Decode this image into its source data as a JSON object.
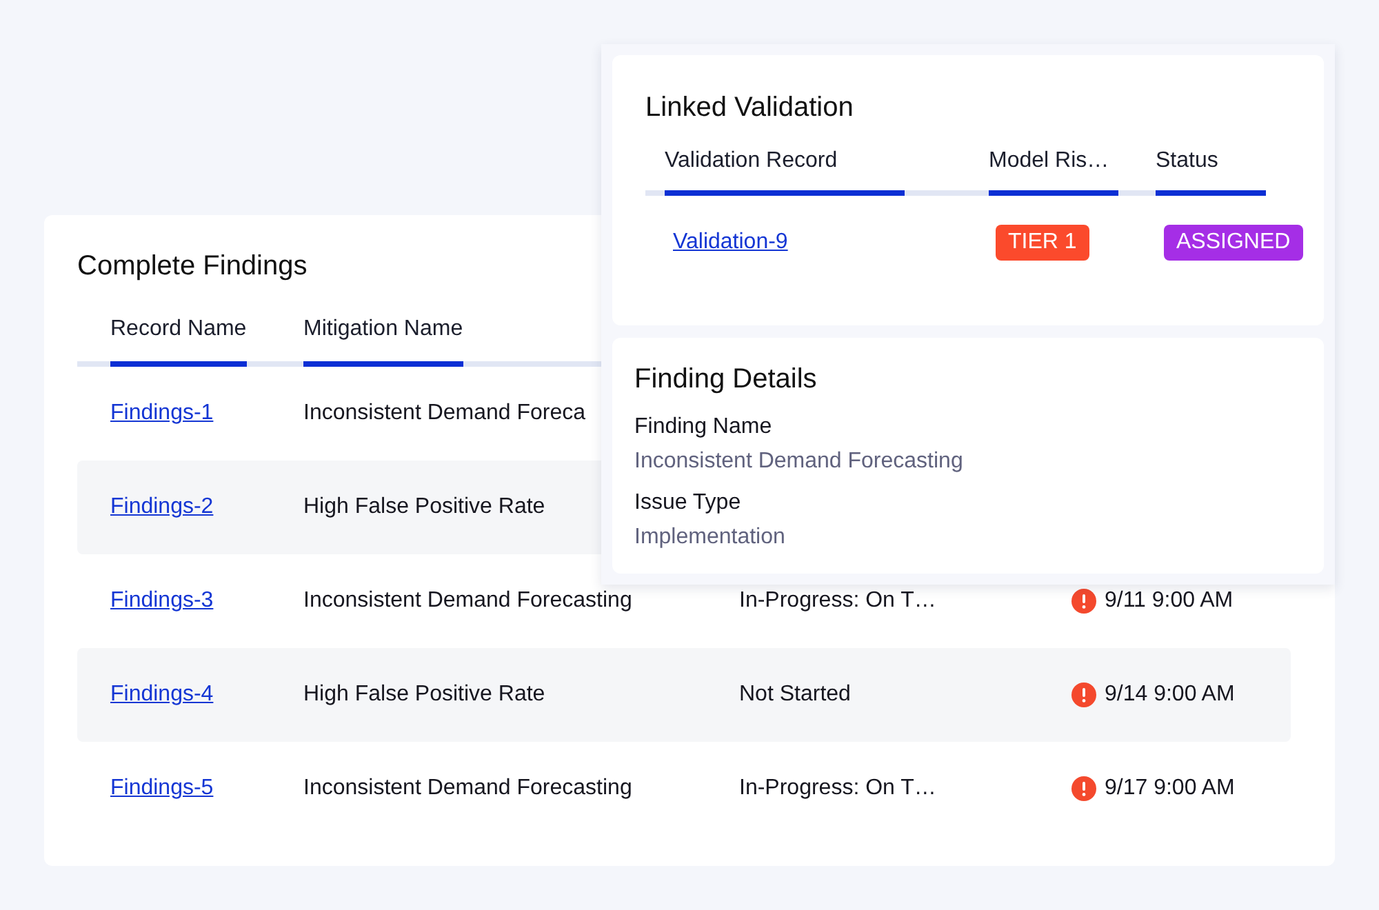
{
  "findings": {
    "title": "Complete Findings",
    "columns": [
      "Record Name",
      "Mitigation Name"
    ],
    "rows": [
      {
        "record": "Findings-1",
        "mitigation": "Inconsistent Demand Foreca"
      },
      {
        "record": "Findings-2",
        "mitigation": "High False Positive Rate"
      },
      {
        "record": "Findings-3",
        "mitigation": "Inconsistent Demand Forecasting",
        "status": "In-Progress: On T…",
        "due": "9/11 9:00 AM",
        "alert": true
      },
      {
        "record": "Findings-4",
        "mitigation": "High False Positive Rate",
        "status": "Not Started",
        "due": "9/14 9:00 AM",
        "alert": true
      },
      {
        "record": "Findings-5",
        "mitigation": "Inconsistent Demand Forecasting",
        "status": "In-Progress: On T…",
        "due": "9/17 9:00 AM",
        "alert": true
      }
    ]
  },
  "linked_validation": {
    "title": "Linked Validation",
    "columns": [
      "Validation Record",
      "Model Ris…",
      "Status"
    ],
    "rows": [
      {
        "record": "Validation-9",
        "risk": {
          "label": "TIER 1",
          "color": "#fb4a2c"
        },
        "status": {
          "label": "ASSIGNED",
          "color": "#a52ee6"
        }
      }
    ]
  },
  "finding_details": {
    "title": "Finding Details",
    "fields": [
      {
        "label": "Finding Name",
        "value": "Inconsistent Demand Forecasting"
      },
      {
        "label": "Issue Type",
        "value": "Implementation"
      }
    ]
  }
}
